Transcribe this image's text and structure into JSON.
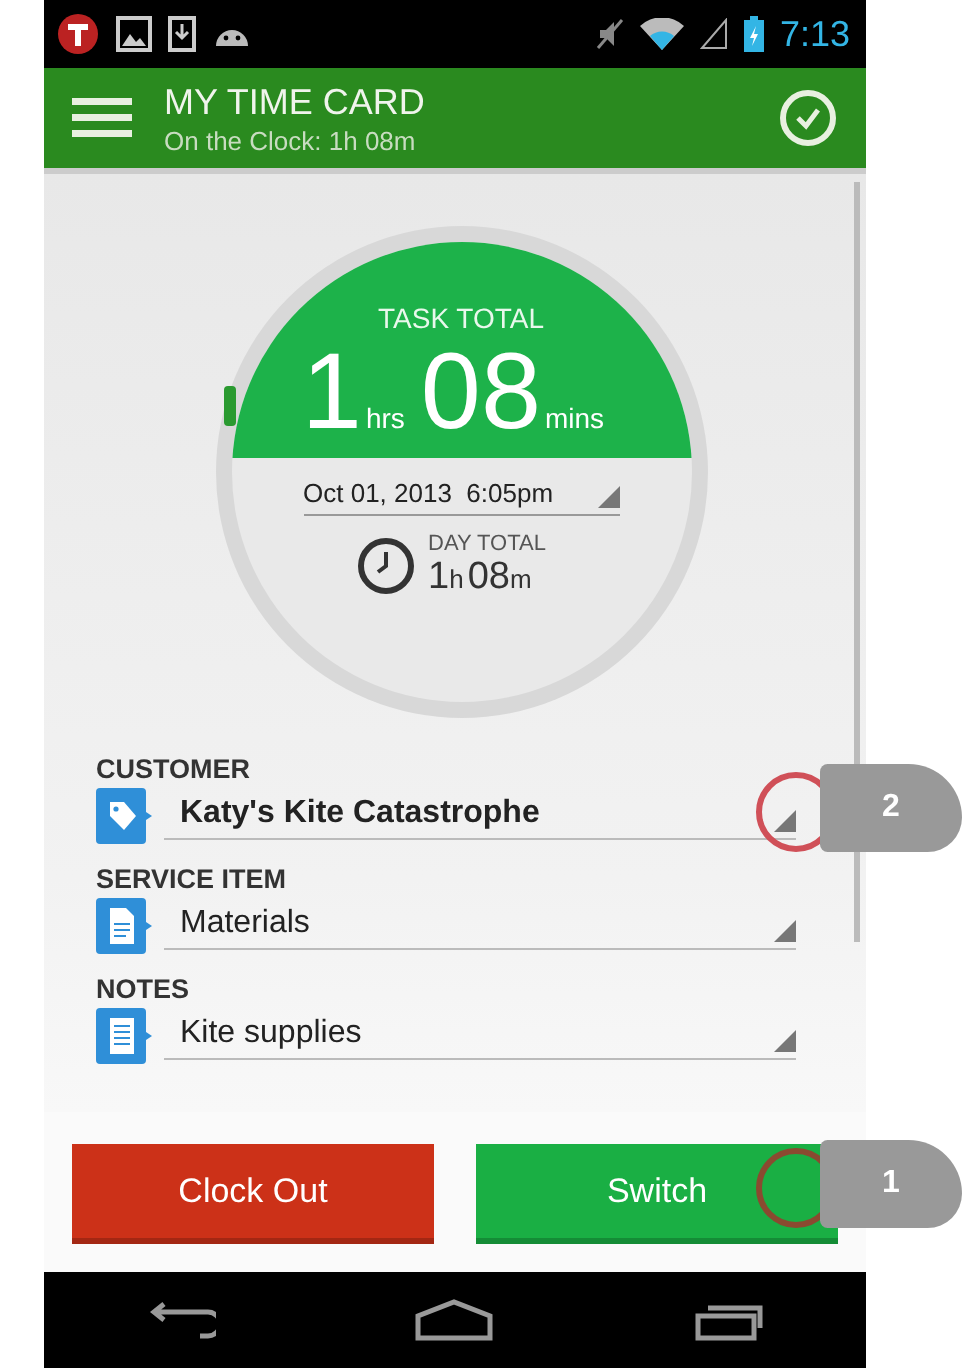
{
  "status_bar": {
    "time": "7:13"
  },
  "app_bar": {
    "title": "MY TIME CARD",
    "subtitle": "On the Clock: 1h 08m"
  },
  "task_total": {
    "label": "TASK TOTAL",
    "hours": "1",
    "hours_unit": "hrs",
    "minutes": "08",
    "minutes_unit": "mins",
    "start": "Oct 01, 2013  6:05pm",
    "day_total_label": "DAY TOTAL",
    "day_hours": "1",
    "day_hours_unit": "h",
    "day_minutes": "08",
    "day_minutes_unit": "m"
  },
  "fields": [
    {
      "kind": "tag",
      "label": "CUSTOMER",
      "value": "Katy's Kite Catastrophe",
      "bold": true
    },
    {
      "kind": "document",
      "label": "SERVICE ITEM",
      "value": "Materials",
      "bold": false
    },
    {
      "kind": "notes",
      "label": "NOTES",
      "value": "Kite supplies",
      "bold": false
    }
  ],
  "buttons": [
    {
      "label": "Clock Out",
      "kind": "danger"
    },
    {
      "label": "Switch",
      "kind": "primary"
    }
  ],
  "callouts": [
    {
      "number": "2",
      "kind": "field"
    },
    {
      "number": "1",
      "kind": "button"
    }
  ]
}
